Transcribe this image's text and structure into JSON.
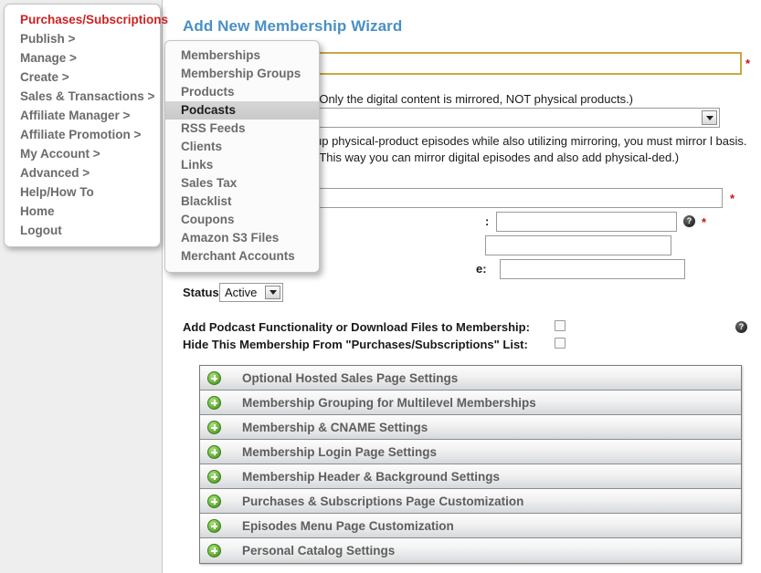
{
  "main_menu": {
    "items": [
      {
        "label": "Purchases/Subscriptions",
        "highlight": true
      },
      {
        "label": "Publish >",
        "highlight": false
      },
      {
        "label": "Manage >",
        "highlight": false
      },
      {
        "label": "Create >",
        "highlight": false
      },
      {
        "label": "Sales & Transactions >",
        "highlight": false
      },
      {
        "label": "Affiliate Manager >",
        "highlight": false
      },
      {
        "label": "Affiliate Promotion >",
        "highlight": false
      },
      {
        "label": "My Account >",
        "highlight": false
      },
      {
        "label": "Advanced >",
        "highlight": false
      },
      {
        "label": "Help/How To",
        "highlight": false
      },
      {
        "label": "Home",
        "highlight": false
      },
      {
        "label": "Logout",
        "highlight": false
      }
    ]
  },
  "submenu": {
    "items": [
      {
        "label": "Memberships",
        "selected": false
      },
      {
        "label": "Membership Groups",
        "selected": false
      },
      {
        "label": "Products",
        "selected": false
      },
      {
        "label": "Podcasts",
        "selected": true
      },
      {
        "label": "RSS Feeds",
        "selected": false
      },
      {
        "label": "Clients",
        "selected": false
      },
      {
        "label": "Links",
        "selected": false
      },
      {
        "label": "Sales Tax",
        "selected": false
      },
      {
        "label": "Blacklist",
        "selected": false
      },
      {
        "label": "Coupons",
        "selected": false
      },
      {
        "label": "Amazon S3 Files",
        "selected": false
      },
      {
        "label": "Merchant Accounts",
        "selected": false
      }
    ]
  },
  "page": {
    "title": "Add New Membership Wizard",
    "required_marker": "*",
    "help_glyph": "?"
  },
  "form": {
    "name_value": "",
    "mirror_note": "(Only the digital content is mirrored, NOT physical products.)",
    "mirror_select_value": "",
    "mirror_paragraph": "up physical-product episodes while also utilizing mirroring, you must mirror l basis. (This way you can mirror digital episodes and also add physical-ded.)",
    "field2_value": "",
    "field3_label": ":",
    "field3_value": "",
    "field4_value": "",
    "field5_label": "e:",
    "field5_value": "",
    "status_label": "Status:",
    "status_value": "Active",
    "checkbox_1_label": "Add Podcast Functionality or Download Files to Membership:",
    "checkbox_2_label": "Hide This Membership From \"Purchases/Subscriptions\" List:"
  },
  "accordion": {
    "sections": [
      {
        "label": "Optional Hosted Sales Page Settings"
      },
      {
        "label": "Membership Grouping for Multilevel Memberships"
      },
      {
        "label": "Membership & CNAME Settings"
      },
      {
        "label": "Membership Login Page Settings"
      },
      {
        "label": "Membership Header & Background Settings"
      },
      {
        "label": "Purchases & Subscriptions Page Customization"
      },
      {
        "label": "Episodes Menu Page Customization"
      },
      {
        "label": "Personal Catalog Settings"
      }
    ]
  },
  "colors": {
    "title_blue": "#4a90c4",
    "menu_highlight_red": "#cc2222",
    "required_red": "#cc1111",
    "focus_border_gold": "#c9a83f",
    "accordion_icon_green": "#6fb83f"
  }
}
